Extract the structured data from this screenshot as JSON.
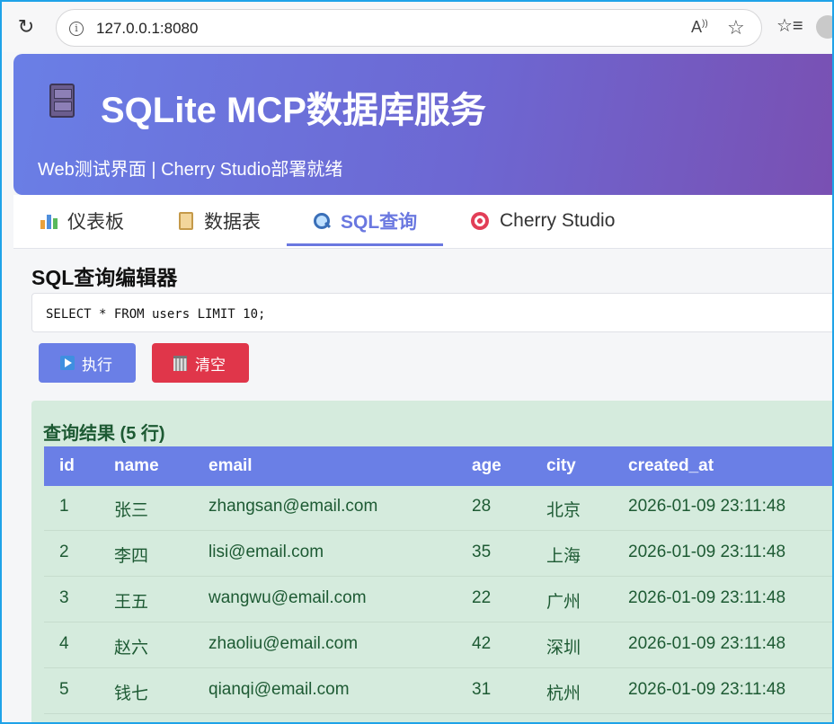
{
  "browser": {
    "url": "127.0.0.1:8080"
  },
  "header": {
    "title": "SQLite MCP数据库服务",
    "subtitle": "Web测试界面 | Cherry Studio部署就绪",
    "icon": "file-cabinet-icon"
  },
  "tabs": [
    {
      "label": "仪表板",
      "icon": "bar-chart-icon",
      "active": false
    },
    {
      "label": "数据表",
      "icon": "clipboard-icon",
      "active": false
    },
    {
      "label": "SQL查询",
      "icon": "magnifier-icon",
      "active": true
    },
    {
      "label": "Cherry Studio",
      "icon": "target-icon",
      "active": false
    }
  ],
  "editor": {
    "title": "SQL查询编辑器",
    "query": "SELECT * FROM users LIMIT 10;",
    "execute_label": "执行",
    "clear_label": "清空"
  },
  "results": {
    "title": "查询结果 (5 行)",
    "columns": [
      "id",
      "name",
      "email",
      "age",
      "city",
      "created_at"
    ],
    "rows": [
      [
        "1",
        "张三",
        "zhangsan@email.com",
        "28",
        "北京",
        "2026-01-09 23:11:48"
      ],
      [
        "2",
        "李四",
        "lisi@email.com",
        "35",
        "上海",
        "2026-01-09 23:11:48"
      ],
      [
        "3",
        "王五",
        "wangwu@email.com",
        "22",
        "广州",
        "2026-01-09 23:11:48"
      ],
      [
        "4",
        "赵六",
        "zhaoliu@email.com",
        "42",
        "深圳",
        "2026-01-09 23:11:48"
      ],
      [
        "5",
        "钱七",
        "qianqi@email.com",
        "31",
        "杭州",
        "2026-01-09 23:11:48"
      ]
    ]
  },
  "colors": {
    "accent": "#6a7fe6",
    "danger": "#e0364a",
    "result_bg": "#d5ebdd",
    "result_text": "#1d5a33"
  }
}
